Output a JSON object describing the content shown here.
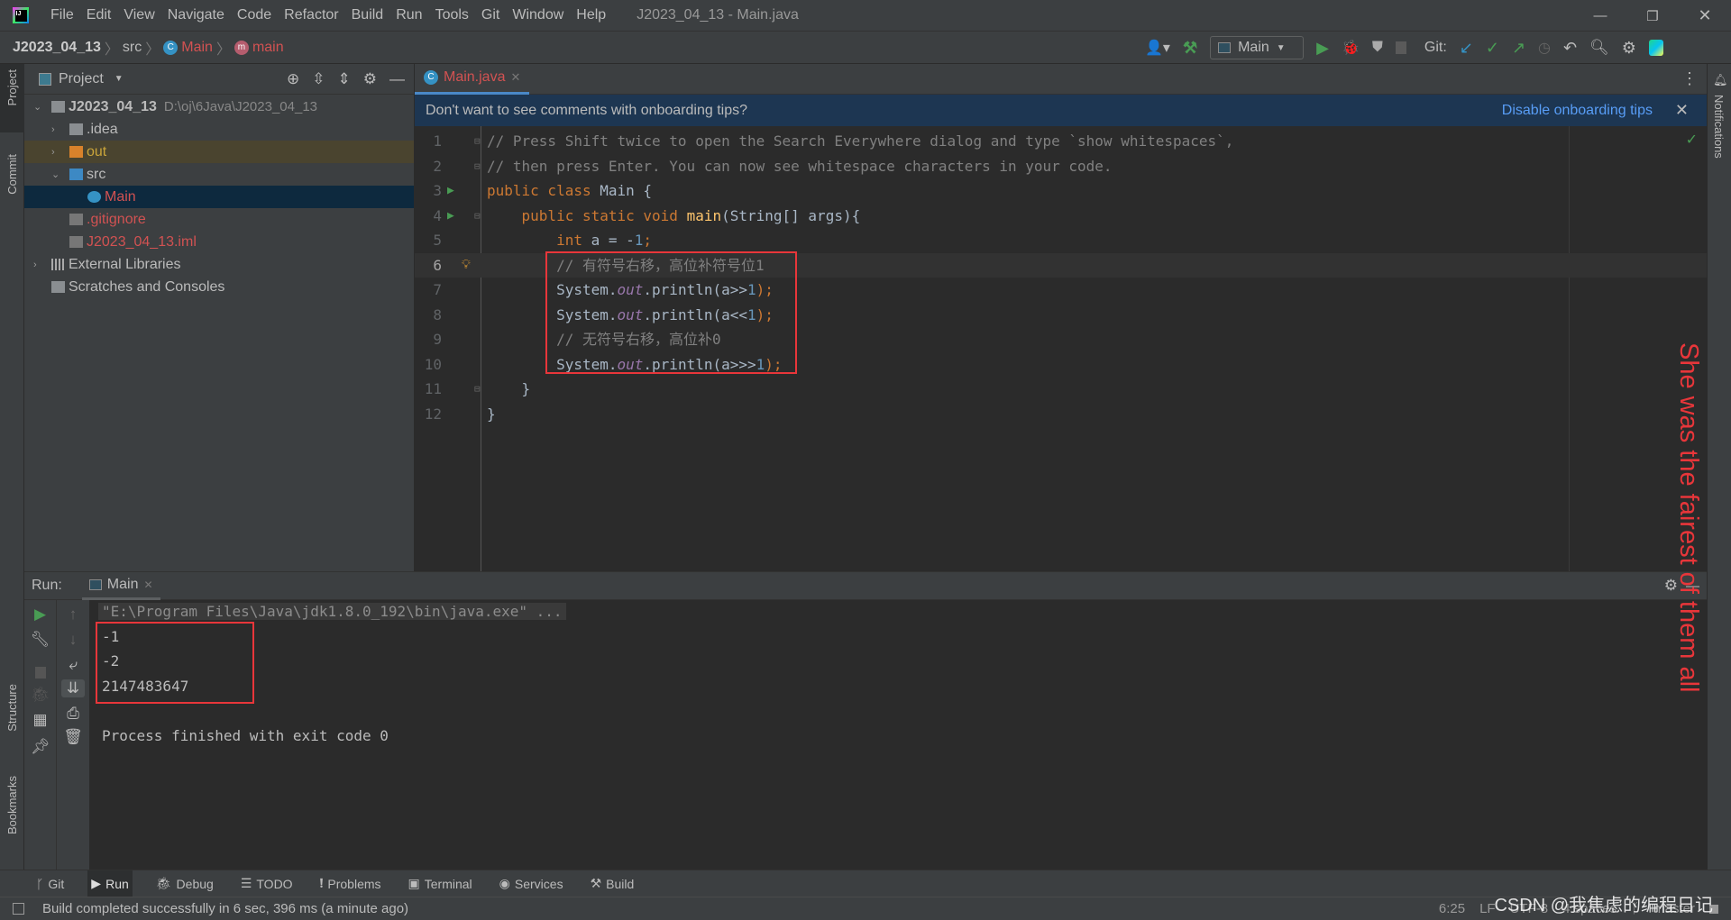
{
  "window_title": "J2023_04_13 - Main.java",
  "menu": [
    "File",
    "Edit",
    "View",
    "Navigate",
    "Code",
    "Refactor",
    "Build",
    "Run",
    "Tools",
    "Git",
    "Window",
    "Help"
  ],
  "breadcrumb": {
    "project": "J2023_04_13",
    "src": "src",
    "class": "Main",
    "method": "main"
  },
  "toolbar": {
    "run_config": "Main",
    "git_label": "Git:"
  },
  "left_strip": {
    "project": "Project",
    "commit": "Commit",
    "structure": "Structure",
    "bookmarks": "Bookmarks"
  },
  "right_strip": {
    "notifications": "Notifications"
  },
  "project_panel": {
    "title": "Project",
    "tree": [
      {
        "label": "J2023_04_13",
        "path": "D:\\oj\\6Java\\J2023_04_13",
        "icon": "project-folder-icon",
        "depth": 0,
        "arrow": "open"
      },
      {
        "label": ".idea",
        "icon": "folder-icon",
        "depth": 1,
        "arrow": "closed"
      },
      {
        "label": "out",
        "icon": "folder-excluded-icon",
        "depth": 1,
        "arrow": "closed"
      },
      {
        "label": "src",
        "icon": "source-folder-icon",
        "depth": 1,
        "arrow": "open"
      },
      {
        "label": "Main",
        "icon": "java-class-icon",
        "depth": 2,
        "selected": true
      },
      {
        "label": ".gitignore",
        "icon": "file-icon",
        "depth": 1
      },
      {
        "label": "J2023_04_13.iml",
        "icon": "file-icon",
        "depth": 1
      },
      {
        "label": "External Libraries",
        "icon": "library-icon",
        "depth": 0,
        "arrow": "closed"
      },
      {
        "label": "Scratches and Consoles",
        "icon": "scratch-icon",
        "depth": 0
      }
    ]
  },
  "editor": {
    "tab": "Main.java",
    "banner_text": "Don't want to see comments with onboarding tips?",
    "banner_action": "Disable onboarding tips",
    "current_line": 6,
    "lines": [
      [
        [
          "// Press Shift twice to open the Search Everywhere dialog and type `show whitespaces`,",
          "cm"
        ]
      ],
      [
        [
          "// then press Enter. You can now see whitespace characters in your code.",
          "cm"
        ]
      ],
      [
        [
          "public class ",
          "kw"
        ],
        [
          "Main {",
          "pl"
        ]
      ],
      [
        [
          "    public static void ",
          "kw"
        ],
        [
          "main",
          "fn"
        ],
        [
          "(String[] args){",
          "pl"
        ]
      ],
      [
        [
          "        int ",
          "kw"
        ],
        [
          "a = -",
          "pl"
        ],
        [
          "1",
          "num"
        ],
        [
          ";",
          "kw"
        ]
      ],
      [
        [
          "        // 有符号右移，高位补符号位1",
          "cm"
        ]
      ],
      [
        [
          "        System.",
          "pl"
        ],
        [
          "out",
          "fld"
        ],
        [
          ".println(a>>",
          "pl"
        ],
        [
          "1",
          "num"
        ],
        [
          ");",
          "kw"
        ]
      ],
      [
        [
          "        System.",
          "pl"
        ],
        [
          "out",
          "fld"
        ],
        [
          ".println(a<<",
          "pl"
        ],
        [
          "1",
          "num"
        ],
        [
          ");",
          "kw"
        ]
      ],
      [
        [
          "        // 无符号右移，高位补0",
          "cm"
        ]
      ],
      [
        [
          "        System.",
          "pl"
        ],
        [
          "out",
          "fld"
        ],
        [
          ".println(a>>>",
          "pl"
        ],
        [
          "1",
          "num"
        ],
        [
          ");",
          "kw"
        ]
      ],
      [
        [
          "    }",
          "pl"
        ]
      ],
      [
        [
          "}",
          "pl"
        ]
      ]
    ]
  },
  "run_panel": {
    "label": "Run:",
    "tab": "Main",
    "command": "\"E:\\Program Files\\Java\\jdk1.8.0_192\\bin\\java.exe\" ...",
    "output": [
      "-1",
      "-2",
      "2147483647"
    ],
    "exit_message": "Process finished with exit code 0"
  },
  "bottom_tabs": [
    "Git",
    "Run",
    "Debug",
    "TODO",
    "Problems",
    "Terminal",
    "Services",
    "Build"
  ],
  "status": {
    "message": "Build completed successfully in 6 sec, 396 ms (a minute ago)",
    "position": "6:25",
    "line_sep": "LF",
    "encoding": "UTF-8",
    "indent": "4 spaces",
    "branch": "master"
  },
  "overlay": {
    "annotation": "She was the fairest of them all",
    "watermark": "CSDN @我焦虑的编程日记"
  },
  "colors": {
    "accent": "#3592c4",
    "annotation_red": "#e8363a",
    "run_green": "#499c54"
  }
}
